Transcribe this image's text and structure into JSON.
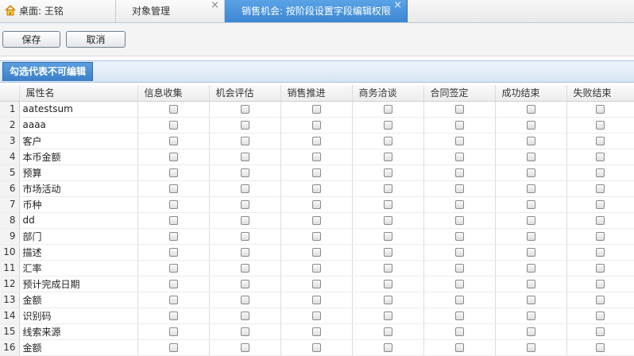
{
  "tabs": [
    {
      "label": "桌面: 王铭",
      "icon": "home-icon",
      "closable": false,
      "active": false
    },
    {
      "label": "对象管理",
      "closable": true,
      "active": false
    },
    {
      "label": "销售机会: 按阶段设置字段编辑权限",
      "closable": true,
      "active": true
    }
  ],
  "tab_close_glyph": "×",
  "toolbar": {
    "save_label": "保存",
    "cancel_label": "取消"
  },
  "section": {
    "title": "勾选代表不可编辑"
  },
  "grid": {
    "columns": [
      "属性名",
      "信息收集",
      "机会评估",
      "销售推进",
      "商务洽谈",
      "合同签定",
      "成功结束",
      "失败结束"
    ],
    "rows": [
      {
        "num": "1",
        "name": "aatestsum"
      },
      {
        "num": "2",
        "name": "aaaa"
      },
      {
        "num": "3",
        "name": "客户"
      },
      {
        "num": "4",
        "name": "本币金额"
      },
      {
        "num": "5",
        "name": "预算"
      },
      {
        "num": "6",
        "name": "市场活动"
      },
      {
        "num": "7",
        "name": "币种"
      },
      {
        "num": "8",
        "name": "dd"
      },
      {
        "num": "9",
        "name": "部门"
      },
      {
        "num": "10",
        "name": "描述"
      },
      {
        "num": "11",
        "name": "汇率"
      },
      {
        "num": "12",
        "name": "预计完成日期"
      },
      {
        "num": "13",
        "name": "金额"
      },
      {
        "num": "14",
        "name": "识别码"
      },
      {
        "num": "15",
        "name": "线索来源"
      },
      {
        "num": "16",
        "name": "金额"
      }
    ]
  },
  "colors": {
    "accent": "#3c86d3",
    "section_bg": "#d7e5f4"
  }
}
